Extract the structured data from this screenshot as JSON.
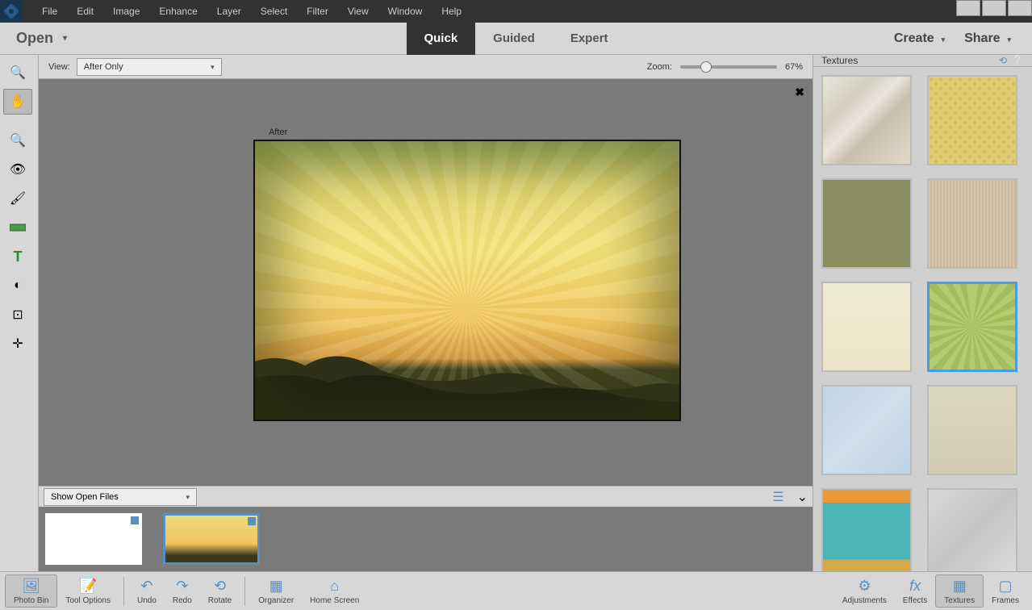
{
  "menubar": {
    "items": [
      "File",
      "Edit",
      "Image",
      "Enhance",
      "Layer",
      "Select",
      "Filter",
      "View",
      "Window",
      "Help"
    ]
  },
  "modebar": {
    "open_label": "Open",
    "tabs": [
      {
        "label": "Quick",
        "active": true
      },
      {
        "label": "Guided",
        "active": false
      },
      {
        "label": "Expert",
        "active": false
      }
    ],
    "create_label": "Create",
    "share_label": "Share"
  },
  "options": {
    "view_label": "View:",
    "view_value": "After Only",
    "zoom_label": "Zoom:",
    "zoom_value": "67%"
  },
  "canvas": {
    "after_label": "After"
  },
  "showfiles": {
    "label": "Show Open Files"
  },
  "right_panel": {
    "title": "Textures",
    "textures": [
      {
        "name": "peeling-paint",
        "bg": "linear-gradient(135deg,#e8e4d8 0%,#d4cfc0 30%,#ebe6da 45%,#c8c0ae 60%,#e0dacb 100%)"
      },
      {
        "name": "yellow-dots",
        "bg": "radial-gradient(circle at 25% 25%,#d4bd5a 2px,transparent 2px),radial-gradient(circle at 75% 75%,#d4bd5a 2px,transparent 2px),#e0cb72"
      },
      {
        "name": "olive-canvas",
        "bg": "linear-gradient(#8a8d5f,#8a8d5f)"
      },
      {
        "name": "beige-fabric",
        "bg": "repeating-linear-gradient(90deg,#d4c5a8 0 2px,#c9ba9c 2px 4px)"
      },
      {
        "name": "cream-paper",
        "bg": "linear-gradient(#f0ead4,#ece4c8)"
      },
      {
        "name": "green-sunburst",
        "bg": "repeating-conic-gradient(from 0deg at 50% 50%,#b5cc6e 0deg 8deg,#a4bd5c 8deg 16deg)",
        "selected": true
      },
      {
        "name": "blue-denim",
        "bg": "linear-gradient(135deg,#c2d4e5 0%,#d0dfec 50%,#bfd1e2 100%)"
      },
      {
        "name": "tan-scratched",
        "bg": "linear-gradient(#dcd6be,#d2ccb4)"
      },
      {
        "name": "teal-paint",
        "bg": "linear-gradient(to bottom,#e89838 0 15%,#4ab5b8 15% 80%,#d4a94a 80% 100%)"
      },
      {
        "name": "silver-foil",
        "bg": "linear-gradient(135deg,#d8d8d8,#c4c4c4,#dcdcdc)"
      }
    ]
  },
  "toolbar": {
    "tools": [
      {
        "name": "zoom-tool",
        "icon": "🔍"
      },
      {
        "name": "hand-tool",
        "icon": "✋",
        "active": true
      },
      {
        "name": "sep"
      },
      {
        "name": "quick-select-tool",
        "icon": "🔍"
      },
      {
        "name": "eye-tool",
        "icon": "👁"
      },
      {
        "name": "whiten-teeth-tool",
        "icon": "🖌"
      },
      {
        "name": "straighten-tool",
        "icon": "📐"
      },
      {
        "name": "text-tool",
        "icon": "T"
      },
      {
        "name": "spot-heal-tool",
        "icon": "◐"
      },
      {
        "name": "crop-tool",
        "icon": "⊡"
      },
      {
        "name": "move-tool",
        "icon": "✛"
      }
    ]
  },
  "taskbar": {
    "left": [
      {
        "name": "photo-bin",
        "label": "Photo Bin",
        "icon": "🖼",
        "active": true
      },
      {
        "name": "tool-options",
        "label": "Tool Options",
        "icon": "📝"
      },
      {
        "name": "sep"
      },
      {
        "name": "undo",
        "label": "Undo",
        "icon": "↶"
      },
      {
        "name": "redo",
        "label": "Redo",
        "icon": "↷"
      },
      {
        "name": "rotate",
        "label": "Rotate",
        "icon": "⟲"
      },
      {
        "name": "sep"
      },
      {
        "name": "organizer",
        "label": "Organizer",
        "icon": "▦"
      },
      {
        "name": "home-screen",
        "label": "Home Screen",
        "icon": "⌂"
      }
    ],
    "right": [
      {
        "name": "adjustments",
        "label": "Adjustments",
        "icon": "⚙"
      },
      {
        "name": "effects",
        "label": "Effects",
        "icon": "fx"
      },
      {
        "name": "textures",
        "label": "Textures",
        "icon": "▦",
        "active": true
      },
      {
        "name": "frames",
        "label": "Frames",
        "icon": "▢"
      }
    ]
  }
}
